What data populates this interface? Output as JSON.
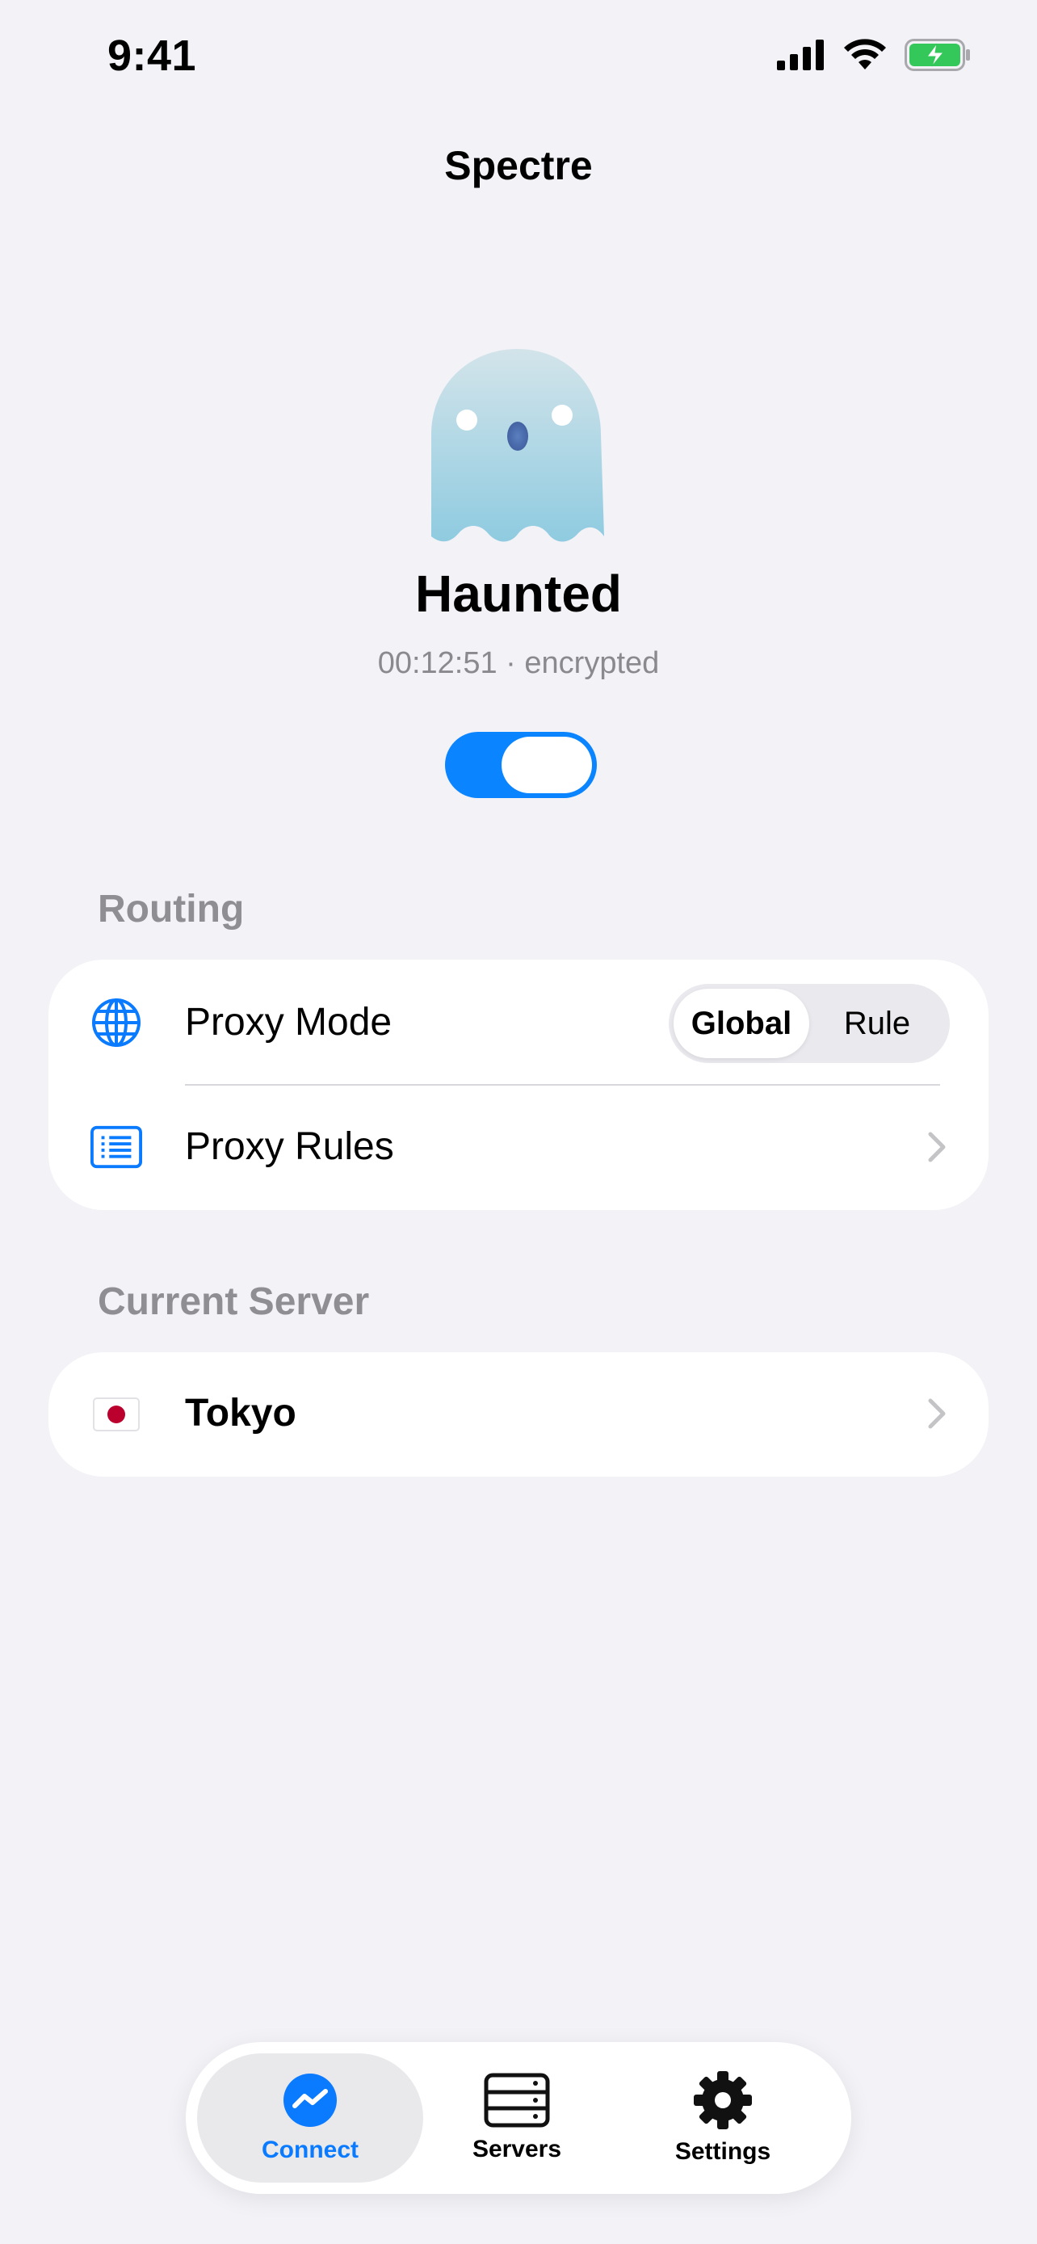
{
  "status_bar": {
    "time": "9:41"
  },
  "nav": {
    "title": "Spectre"
  },
  "hero": {
    "status": "Haunted",
    "detail": "00:12:51 · encrypted",
    "connected": true
  },
  "routing": {
    "header": "Routing",
    "proxy_mode": {
      "label": "Proxy Mode",
      "icon": "globe-icon",
      "options": [
        "Global",
        "Rule"
      ],
      "selected": "Global"
    },
    "proxy_rules": {
      "label": "Proxy Rules",
      "icon": "list-icon"
    }
  },
  "server": {
    "header": "Current Server",
    "flag": "🇯🇵",
    "name": "Tokyo"
  },
  "tabbar": {
    "tabs": [
      {
        "label": "Connect",
        "icon": "connect-icon",
        "active": true
      },
      {
        "label": "Servers",
        "icon": "servers-icon",
        "active": false
      },
      {
        "label": "Settings",
        "icon": "gear-icon",
        "active": false
      }
    ]
  },
  "colors": {
    "accent": "#0a84ff",
    "background": "#f2f2f7",
    "secondary_text": "#8e8e93"
  }
}
